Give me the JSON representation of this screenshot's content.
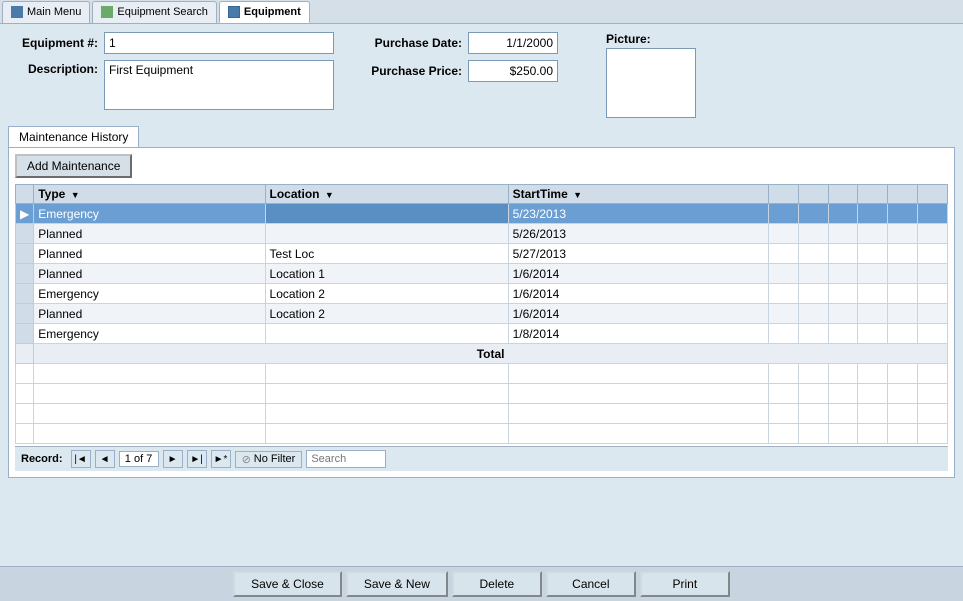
{
  "tabs": [
    {
      "id": "main-menu",
      "label": "Main Menu",
      "icon": "home",
      "active": false
    },
    {
      "id": "equipment-search",
      "label": "Equipment Search",
      "icon": "search",
      "active": false
    },
    {
      "id": "equipment",
      "label": "Equipment",
      "icon": "table",
      "active": true
    }
  ],
  "form": {
    "equipment_number_label": "Equipment #:",
    "equipment_number_value": "1",
    "description_label": "Description:",
    "description_value": "First Equipment",
    "purchase_date_label": "Purchase Date:",
    "purchase_date_value": "1/1/2000",
    "purchase_price_label": "Purchase Price:",
    "purchase_price_value": "$250.00",
    "picture_label": "Picture:"
  },
  "maintenance": {
    "panel_title": "Maintenance History",
    "add_button": "Add Maintenance",
    "columns": [
      {
        "key": "type",
        "label": "Type"
      },
      {
        "key": "location",
        "label": "Location"
      },
      {
        "key": "start_time",
        "label": "StartTime"
      }
    ],
    "rows": [
      {
        "selected": true,
        "type": "Emergency",
        "location": "",
        "start_time": "5/23/2013"
      },
      {
        "selected": false,
        "type": "Planned",
        "location": "",
        "start_time": "5/26/2013"
      },
      {
        "selected": false,
        "type": "Planned",
        "location": "Test Loc",
        "start_time": "5/27/2013"
      },
      {
        "selected": false,
        "type": "Planned",
        "location": "Location 1",
        "start_time": "1/6/2014"
      },
      {
        "selected": false,
        "type": "Emergency",
        "location": "Location 2",
        "start_time": "1/6/2014"
      },
      {
        "selected": false,
        "type": "Planned",
        "location": "Location 2",
        "start_time": "1/6/2014"
      },
      {
        "selected": false,
        "type": "Emergency",
        "location": "",
        "start_time": "1/8/2014"
      }
    ],
    "total_label": "Total"
  },
  "nav": {
    "record_label": "Record:",
    "current_record": "1 of 7",
    "no_filter_label": "No Filter",
    "search_placeholder": "Search"
  },
  "buttons": {
    "save_close": "Save & Close",
    "save_new": "Save & New",
    "delete": "Delete",
    "cancel": "Cancel",
    "print": "Print"
  }
}
